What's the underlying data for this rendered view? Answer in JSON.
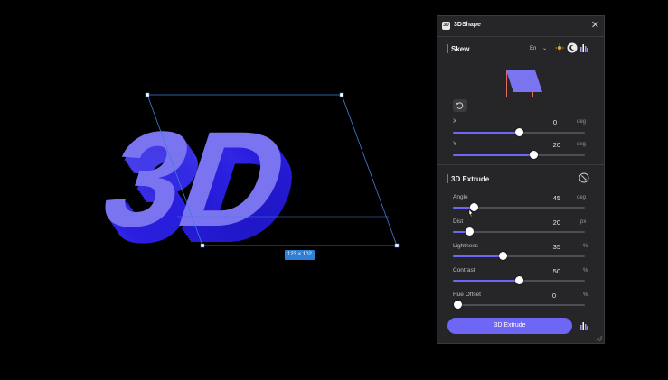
{
  "app": {
    "title": "3DShape",
    "logo_text": "3D"
  },
  "canvas": {
    "text": "3D",
    "size_label": "123 × 102",
    "colors": {
      "face": "#7b74f0",
      "side": "#2a1fe0",
      "selection": "#3f7fd8"
    }
  },
  "skew": {
    "title": "Skew",
    "lang": "En",
    "controls": [
      {
        "label": "X",
        "value": "0",
        "unit": "deg",
        "level": 0.5
      },
      {
        "label": "Y",
        "value": "20",
        "unit": "deg",
        "level": 0.61
      }
    ]
  },
  "extrude": {
    "title": "3D Extrude",
    "controls": [
      {
        "label": "Angle",
        "value": "45",
        "unit": "deg",
        "level": 0.16
      },
      {
        "label": "Dist",
        "value": "20",
        "unit": "px",
        "level": 0.13
      },
      {
        "label": "Lightness",
        "value": "35",
        "unit": "%",
        "level": 0.38
      },
      {
        "label": "Contrast",
        "value": "50",
        "unit": "%",
        "level": 0.5
      },
      {
        "label": "Hue Offset",
        "value": "0",
        "unit": "%",
        "level": 0.0
      }
    ],
    "button_label": "3D Extrude"
  },
  "theme": {
    "accent": "#6e66f5",
    "panel_bg": "#262629"
  }
}
